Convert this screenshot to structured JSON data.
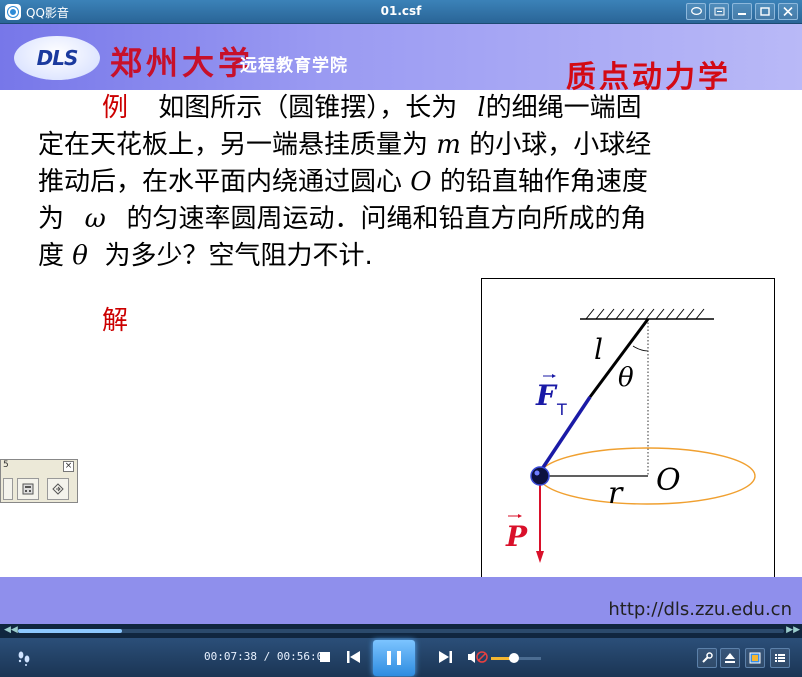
{
  "titlebar": {
    "app_name": "QQ影音",
    "document": "01.csf"
  },
  "slide": {
    "logo_text": "DLS",
    "university": "郑州大学",
    "school": "远程教育学院",
    "topic": "质点动力学",
    "problem": {
      "label": "例",
      "line1a": "如图所示（圆锥摆），长为",
      "var_l": "l",
      "line1b": "的细绳一端固",
      "line2a": "定在天花板上，另一端悬挂质量为",
      "var_m": "m",
      "line2b": "的小球，小球经",
      "line3a": "推动后，在水平面内绕通过圆心",
      "var_O": "O",
      "line3b": "的铅直轴作角速度",
      "line4a": "为",
      "var_omega": "ω",
      "line4b": "的匀速率圆周运动．问绳和铅直方向所成的角",
      "line5a": "度",
      "var_theta": "θ",
      "line5b": "为多少？空气阻力不计."
    },
    "solution_label": "解",
    "figure": {
      "label_l": "l",
      "label_theta": "θ",
      "label_F": "F",
      "label_F_sub": "T",
      "label_O": "O",
      "label_r": "r",
      "label_P": "P"
    },
    "url": "http://dls.zzu.edu.cn"
  },
  "float_toolbar": {
    "caption": "5",
    "close": "×"
  },
  "player": {
    "time_current": "00:07:38",
    "time_total": "00:56:00",
    "time_separator": " / ",
    "progress": 0.136,
    "volume": 0.45,
    "state": "playing"
  },
  "colors": {
    "slide_banner": "#8e8ef0",
    "red_text": "#cc0000",
    "rope_force": "#1a1aa6",
    "orbit": "#f0a030",
    "player_bg": "#1b3554"
  }
}
